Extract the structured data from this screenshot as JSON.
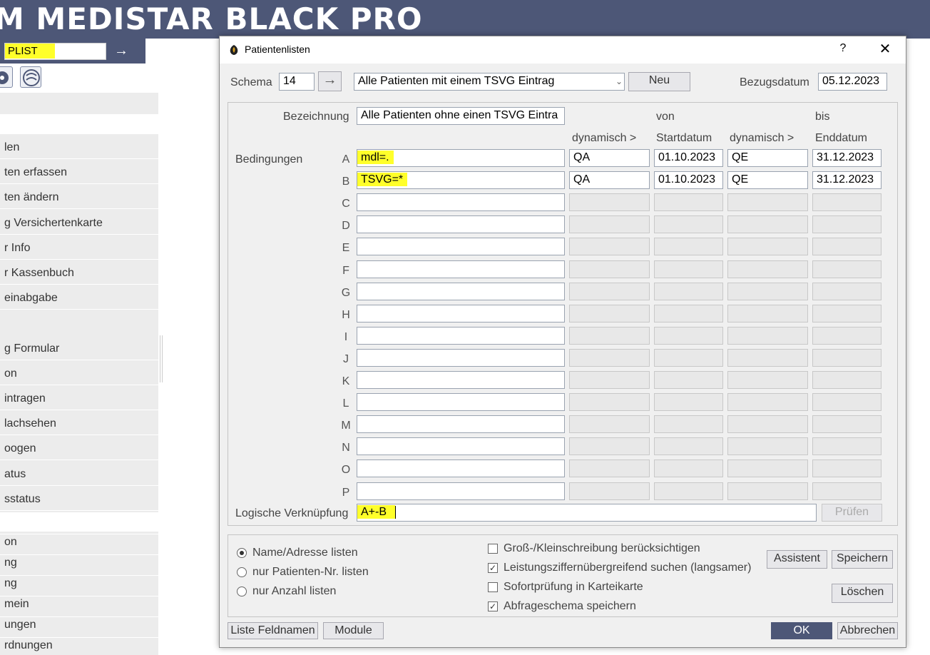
{
  "app": {
    "title": "M MEDISTAR BLACK PRO",
    "command_value": "PLIST",
    "go_icon": "arrow-right-icon"
  },
  "sidebar": {
    "items": [
      "len",
      "ten erfassen",
      "ten ändern",
      "g Versichertenkarte",
      "r Info",
      "r Kassenbuch",
      "einabgabe",
      "g Formular",
      "on",
      "intragen",
      "lachsehen",
      "oogen",
      "atus",
      "sstatus"
    ],
    "items2": [
      "on",
      "ng",
      "ng",
      "mein",
      "ungen",
      "rdnungen"
    ]
  },
  "dialog": {
    "title": "Patientenlisten",
    "help": "?",
    "close": "✕",
    "schema_label": "Schema",
    "schema_number": "14",
    "schema_go": "→",
    "schema_name": "Alle Patienten mit einem TSVG Eintrag",
    "new_button": "Neu",
    "ref_date_label": "Bezugsdatum",
    "ref_date": "05.12.2023",
    "designation_label": "Bezeichnung",
    "designation_value": "Alle Patienten ohne einen TSVG Eintra",
    "col_von": "von",
    "col_bis": "bis",
    "col_dyn1": "dynamisch >",
    "col_start": "Startdatum",
    "col_dyn2": "dynamisch >",
    "col_end": "Enddatum",
    "conditions_label": "Bedingungen",
    "conditions": [
      {
        "letter": "A",
        "value": "mdl=.",
        "dyn1": "QA",
        "start": "01.10.2023",
        "dyn2": "QE",
        "end": "31.12.2023"
      },
      {
        "letter": "B",
        "value": "TSVG=*",
        "dyn1": "QA",
        "start": "01.10.2023",
        "dyn2": "QE",
        "end": "31.12.2023"
      },
      {
        "letter": "C",
        "value": "",
        "dyn1": "",
        "start": "",
        "dyn2": "",
        "end": ""
      },
      {
        "letter": "D",
        "value": "",
        "dyn1": "",
        "start": "",
        "dyn2": "",
        "end": ""
      },
      {
        "letter": "E",
        "value": "",
        "dyn1": "",
        "start": "",
        "dyn2": "",
        "end": ""
      },
      {
        "letter": "F",
        "value": "",
        "dyn1": "",
        "start": "",
        "dyn2": "",
        "end": ""
      },
      {
        "letter": "G",
        "value": "",
        "dyn1": "",
        "start": "",
        "dyn2": "",
        "end": ""
      },
      {
        "letter": "H",
        "value": "",
        "dyn1": "",
        "start": "",
        "dyn2": "",
        "end": ""
      },
      {
        "letter": "I",
        "value": "",
        "dyn1": "",
        "start": "",
        "dyn2": "",
        "end": ""
      },
      {
        "letter": "J",
        "value": "",
        "dyn1": "",
        "start": "",
        "dyn2": "",
        "end": ""
      },
      {
        "letter": "K",
        "value": "",
        "dyn1": "",
        "start": "",
        "dyn2": "",
        "end": ""
      },
      {
        "letter": "L",
        "value": "",
        "dyn1": "",
        "start": "",
        "dyn2": "",
        "end": ""
      },
      {
        "letter": "M",
        "value": "",
        "dyn1": "",
        "start": "",
        "dyn2": "",
        "end": ""
      },
      {
        "letter": "N",
        "value": "",
        "dyn1": "",
        "start": "",
        "dyn2": "",
        "end": ""
      },
      {
        "letter": "O",
        "value": "",
        "dyn1": "",
        "start": "",
        "dyn2": "",
        "end": ""
      },
      {
        "letter": "P",
        "value": "",
        "dyn1": "",
        "start": "",
        "dyn2": "",
        "end": ""
      }
    ],
    "logic_label": "Logische Verknüpfung",
    "logic_value": "A+-B",
    "check_button": "Prüfen",
    "radio_options": [
      "Name/Adresse listen",
      "nur Patienten-Nr. listen",
      "nur Anzahl listen"
    ],
    "radio_selected": 0,
    "checkboxes": [
      {
        "label": "Groß-/Kleinschreibung berücksichtigen",
        "checked": false
      },
      {
        "label": "Leistungsziffernübergreifend suchen (langsamer)",
        "checked": true
      },
      {
        "label": "Sofortprüfung in Karteikarte",
        "checked": false
      },
      {
        "label": "Abfrageschema speichern",
        "checked": true
      }
    ],
    "assistant_button": "Assistent",
    "save_button": "Speichern",
    "delete_button": "Löschen",
    "field_names_button": "Liste Feldnamen",
    "modules_button": "Module",
    "ok_button": "OK",
    "cancel_button": "Abbrechen"
  },
  "colors": {
    "brand": "#4d5777",
    "highlight": "#ffff2a"
  }
}
